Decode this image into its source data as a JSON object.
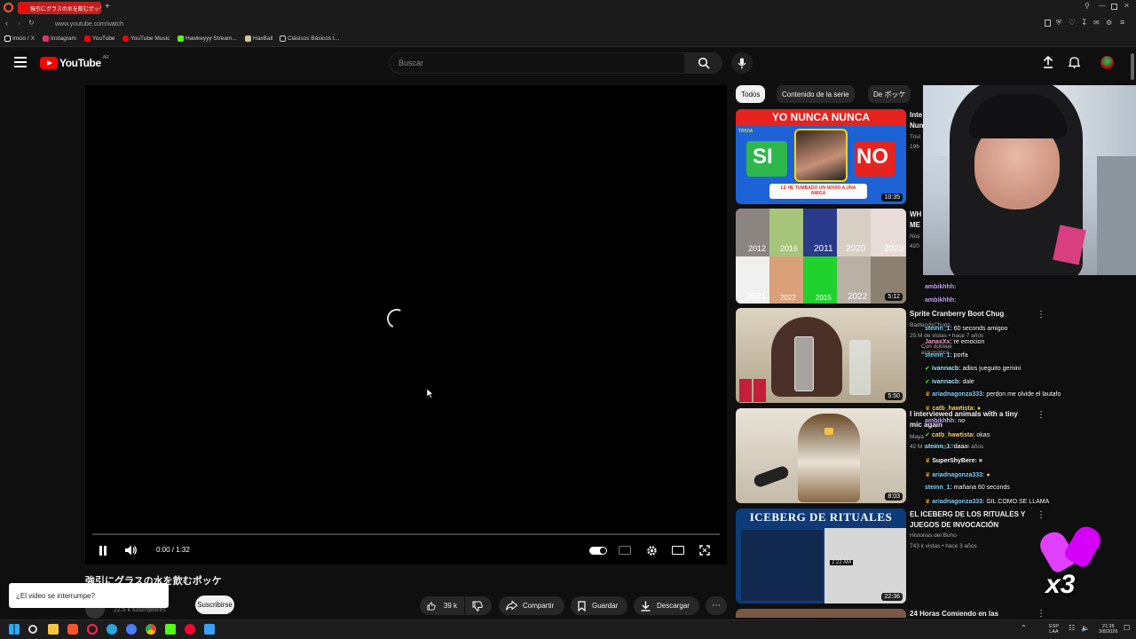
{
  "browser": {
    "tab_title": "強引にグラスの水を飲むポッケ",
    "url": "www.youtube.com/watch",
    "bookmarks": [
      {
        "label": "Inicio / X",
        "color": "#ffffff"
      },
      {
        "label": "Instagram",
        "color": "#e1306c"
      },
      {
        "label": "YouTube",
        "color": "#ff0000"
      },
      {
        "label": "YouTube Music",
        "color": "#ff0000"
      },
      {
        "label": "Hawkeyyy Stream...",
        "color": "#53fc18"
      },
      {
        "label": "HaxBall",
        "color": "#c8c8a0"
      },
      {
        "label": "Clásicos Básicos t...",
        "color": "#cccccc"
      }
    ]
  },
  "youtube": {
    "logo_text": "YouTube",
    "country_code": "AR",
    "search_placeholder": "Buscar"
  },
  "player": {
    "time": "0:00 / 1:32",
    "progress_fraction": 0.0
  },
  "video": {
    "title": "強引にグラスの水を飲むポッケ",
    "subscribers": "22.5 k suscriptores",
    "subscribe_label": "Suscribirse",
    "likes": "39 k",
    "share_label": "Compartir",
    "save_label": "Guardar",
    "download_label": "Descargar"
  },
  "tooltip": {
    "text": "¿El video se interrumpe?"
  },
  "chips": [
    "Todos",
    "Contenido de la serie",
    "De ポッケ"
  ],
  "recommendations": [
    {
      "duration": "10:35",
      "title": "Inte Nun",
      "meta1": "Trivi",
      "meta2": "196",
      "thumb_text": "YO NUNCA NUNCA",
      "yes": "SI",
      "no": "NO",
      "caption": "LE HE TUMBADO UN NOVIO A UNA AMIGA",
      "badge": "TRIVIA"
    },
    {
      "duration": "5:12",
      "title": "WH ME",
      "meta1": "Nos",
      "meta2": "420",
      "years": [
        "2012",
        "2016",
        "2011",
        "2020",
        "2023",
        "2021",
        "2022",
        "2015",
        "2022"
      ]
    },
    {
      "duration": "5:50",
      "title": "Sprite Cranberry Boot Chug",
      "meta1": "BadlandsChugs",
      "meta2": "25 M de vistas • hace 7 años",
      "meta3": "Con doblaje automático"
    },
    {
      "duration": "8:03",
      "title": "I interviewed animals with a tiny mic again",
      "meta1": "Maya",
      "meta2": "42 M de vistas • hace 4 años"
    },
    {
      "duration": "22:36",
      "title": "EL ICEBERG DE LOS RITUALES Y JUEGOS DE INVOCACIÓN",
      "meta1": "Historias del Buho",
      "meta2": "743 k vistas • hace 3 años",
      "thumb_text": "ICEBERG DE RITUALES",
      "cap_time": "2:22 AM"
    },
    {
      "title": "24 Horas Comiendo en las"
    }
  ],
  "chat": [
    {
      "user": "ambikhhh:",
      "msg": "",
      "color": "#c8a2ff"
    },
    {
      "user": "ambikhhh:",
      "msg": "",
      "color": "#c8a2ff"
    },
    {
      "user": "steinn_1:",
      "msg": "60 seconds amigoo",
      "color": "#7fdcff"
    },
    {
      "user": "JanaxXx:",
      "msg": "re emocion",
      "color": "#ff9bd2"
    },
    {
      "user": "steinn_1:",
      "msg": "porfa",
      "color": "#7fdcff"
    },
    {
      "user": "ivannacb:",
      "msg": "adios jueguito gemini",
      "color": "#9be7ff"
    },
    {
      "user": "ivannacb:",
      "msg": "dale",
      "color": "#9be7ff"
    },
    {
      "user": "ariadnagonza333:",
      "msg": "perdon me olvide el lautafo",
      "color": "#7fd3ff"
    },
    {
      "user": "catb_hawtista:",
      "msg": "",
      "color": "#ffd36b"
    },
    {
      "user": "ambikhhh:",
      "msg": "no",
      "color": "#c8a2ff"
    },
    {
      "user": "catb_hawtista:",
      "msg": "okas",
      "color": "#ffd36b"
    },
    {
      "user": "steinn_1:",
      "msg": "daaa",
      "color": "#7fdcff"
    },
    {
      "user": "SuperShyBere:",
      "msg": "",
      "color": "#ffffff"
    },
    {
      "user": "ariadnagonza333:",
      "msg": "",
      "color": "#7fd3ff"
    },
    {
      "user": "steinn_1:",
      "msg": "mañana 60 seconds",
      "color": "#7fdcff"
    },
    {
      "user": "ariadnagonza333:",
      "msg": "GIL COMO SE LLAMA",
      "color": "#7fd3ff"
    }
  ],
  "overlay": {
    "multiplier": "x3"
  },
  "taskbar": {
    "lang": "ESP",
    "region": "LAA",
    "time": "21:28",
    "date": "3/8/2026"
  }
}
